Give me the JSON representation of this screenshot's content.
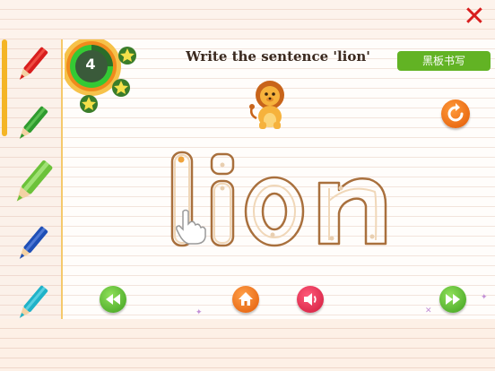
{
  "game": {
    "title": "Write the sentence 'lion'",
    "level": "4",
    "board_button": "黑板书写",
    "word": "lion",
    "stars_count": 4
  },
  "pencils": [
    {
      "color": "#d81e1e",
      "name": "red"
    },
    {
      "color": "#2f9b2f",
      "name": "green"
    },
    {
      "color": "#6cc23a",
      "name": "light-green"
    },
    {
      "color": "#1f4fb6",
      "name": "blue"
    },
    {
      "color": "#1fb2c8",
      "name": "cyan"
    }
  ],
  "colors": {
    "close": "#d81e1e",
    "board_button_bg": "#62b324",
    "accent_orange": "#f08a1c",
    "level_ring_green": "#34c934"
  },
  "icons": {
    "close": "close-icon",
    "reload": "reload-icon",
    "prev": "rewind-icon",
    "home": "home-icon",
    "sound": "sound-icon",
    "next": "forward-icon",
    "hand": "hand-pointer-icon"
  }
}
